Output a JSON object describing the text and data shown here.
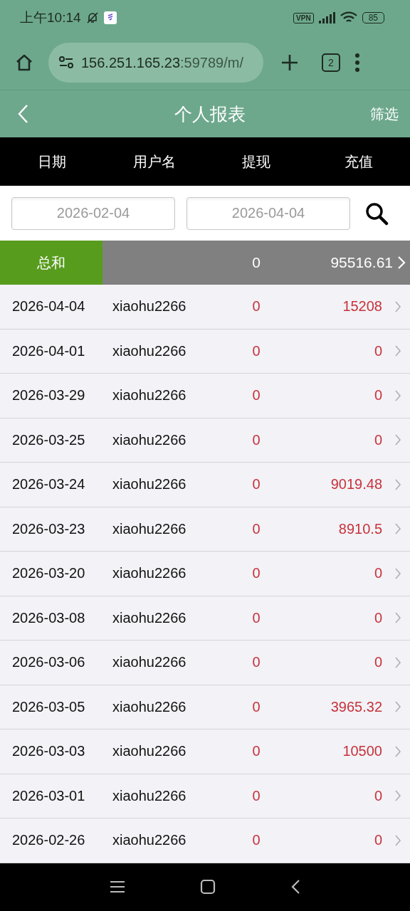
{
  "status_bar": {
    "time": "上午10:14",
    "battery": "85",
    "vpn": "VPN"
  },
  "browser": {
    "url_host": "156.251.165.23",
    "url_rest": ":59789/m/",
    "tab_count": "2"
  },
  "header": {
    "title": "个人报表",
    "filter": "筛选"
  },
  "columns": [
    "日期",
    "用户名",
    "提现",
    "充值"
  ],
  "date_range": {
    "start": "2026-02-04",
    "end": "2026-04-04"
  },
  "total": {
    "label": "总和",
    "withdraw": "0",
    "recharge": "95516.61"
  },
  "rows": [
    {
      "date": "2026-04-04",
      "username": "xiaohu2266",
      "withdraw": "0",
      "recharge": "15208"
    },
    {
      "date": "2026-04-01",
      "username": "xiaohu2266",
      "withdraw": "0",
      "recharge": "0"
    },
    {
      "date": "2026-03-29",
      "username": "xiaohu2266",
      "withdraw": "0",
      "recharge": "0"
    },
    {
      "date": "2026-03-25",
      "username": "xiaohu2266",
      "withdraw": "0",
      "recharge": "0"
    },
    {
      "date": "2026-03-24",
      "username": "xiaohu2266",
      "withdraw": "0",
      "recharge": "9019.48"
    },
    {
      "date": "2026-03-23",
      "username": "xiaohu2266",
      "withdraw": "0",
      "recharge": "8910.5"
    },
    {
      "date": "2026-03-20",
      "username": "xiaohu2266",
      "withdraw": "0",
      "recharge": "0"
    },
    {
      "date": "2026-03-08",
      "username": "xiaohu2266",
      "withdraw": "0",
      "recharge": "0"
    },
    {
      "date": "2026-03-06",
      "username": "xiaohu2266",
      "withdraw": "0",
      "recharge": "0"
    },
    {
      "date": "2026-03-05",
      "username": "xiaohu2266",
      "withdraw": "0",
      "recharge": "3965.32"
    },
    {
      "date": "2026-03-03",
      "username": "xiaohu2266",
      "withdraw": "0",
      "recharge": "10500"
    },
    {
      "date": "2026-03-01",
      "username": "xiaohu2266",
      "withdraw": "0",
      "recharge": "0"
    },
    {
      "date": "2026-02-26",
      "username": "xiaohu2266",
      "withdraw": "0",
      "recharge": "0"
    }
  ]
}
